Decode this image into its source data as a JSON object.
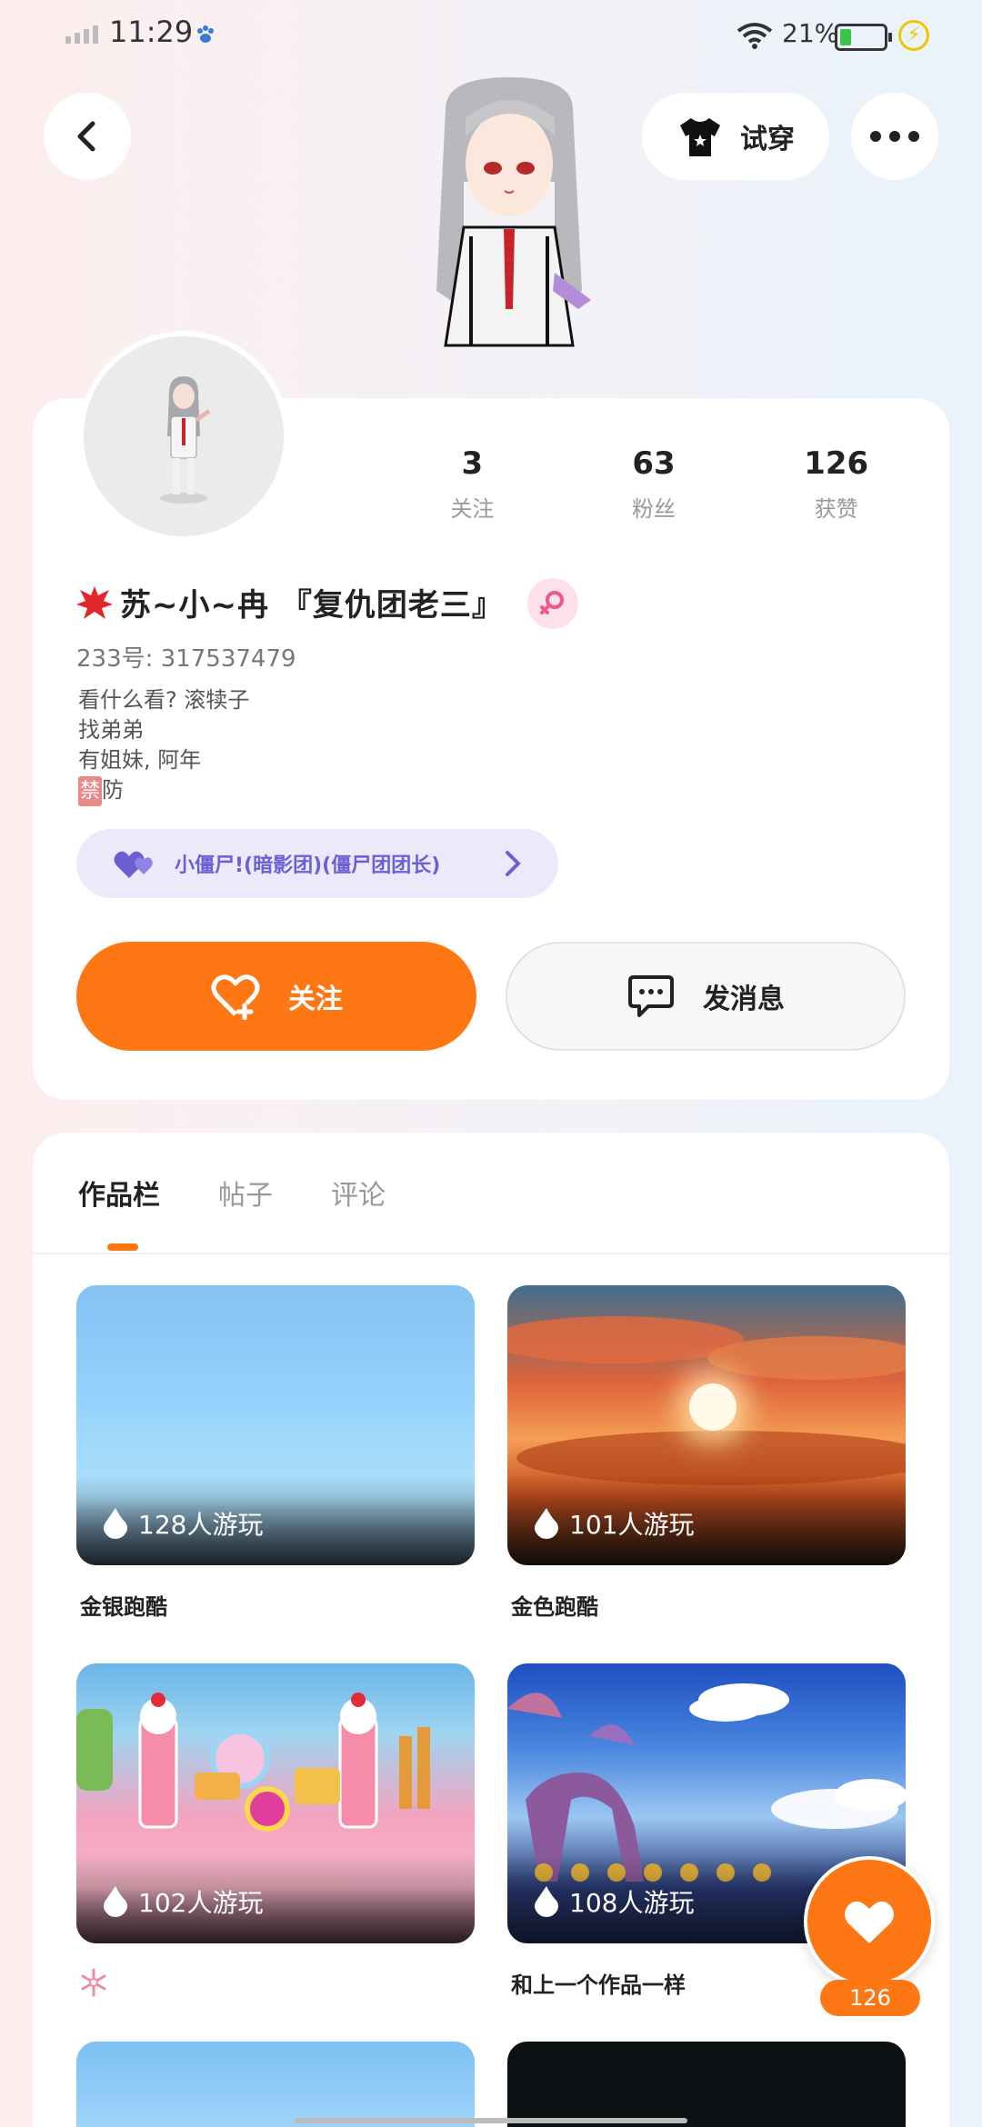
{
  "status_bar": {
    "time": "11:29",
    "battery": "21%"
  },
  "header": {
    "try_on_label": "试穿"
  },
  "profile": {
    "stats": [
      {
        "value": "3",
        "label": "关注"
      },
      {
        "value": "63",
        "label": "粉丝"
      },
      {
        "value": "126",
        "label": "获赞"
      }
    ],
    "name": "苏~小~冉 『复仇团老三』",
    "uid": "233号:  317537479",
    "bio_lines": [
      "看什么看? 滚犊子",
      "找弟弟",
      "有姐妹, 阿年"
    ],
    "bio_ban_badge": "禁",
    "bio_ban_text": "防",
    "group": "小僵尸!(暗影团)(僵尸团团长)",
    "follow_label": "关注",
    "message_label": "发消息"
  },
  "tabs": [
    {
      "label": "作品栏",
      "active": true
    },
    {
      "label": "帖子",
      "active": false
    },
    {
      "label": "评论",
      "active": false
    }
  ],
  "works": [
    {
      "plays": "128人游玩",
      "title": "金银跑酷"
    },
    {
      "plays": "101人游玩",
      "title": "金色跑酷"
    },
    {
      "plays": "102人游玩",
      "title": ""
    },
    {
      "plays": "108人游玩",
      "title": "和上一个作品一样"
    }
  ],
  "like_fab": {
    "count": "126"
  },
  "colors": {
    "accent": "#fd7814",
    "group_text": "#6b5fd3"
  }
}
